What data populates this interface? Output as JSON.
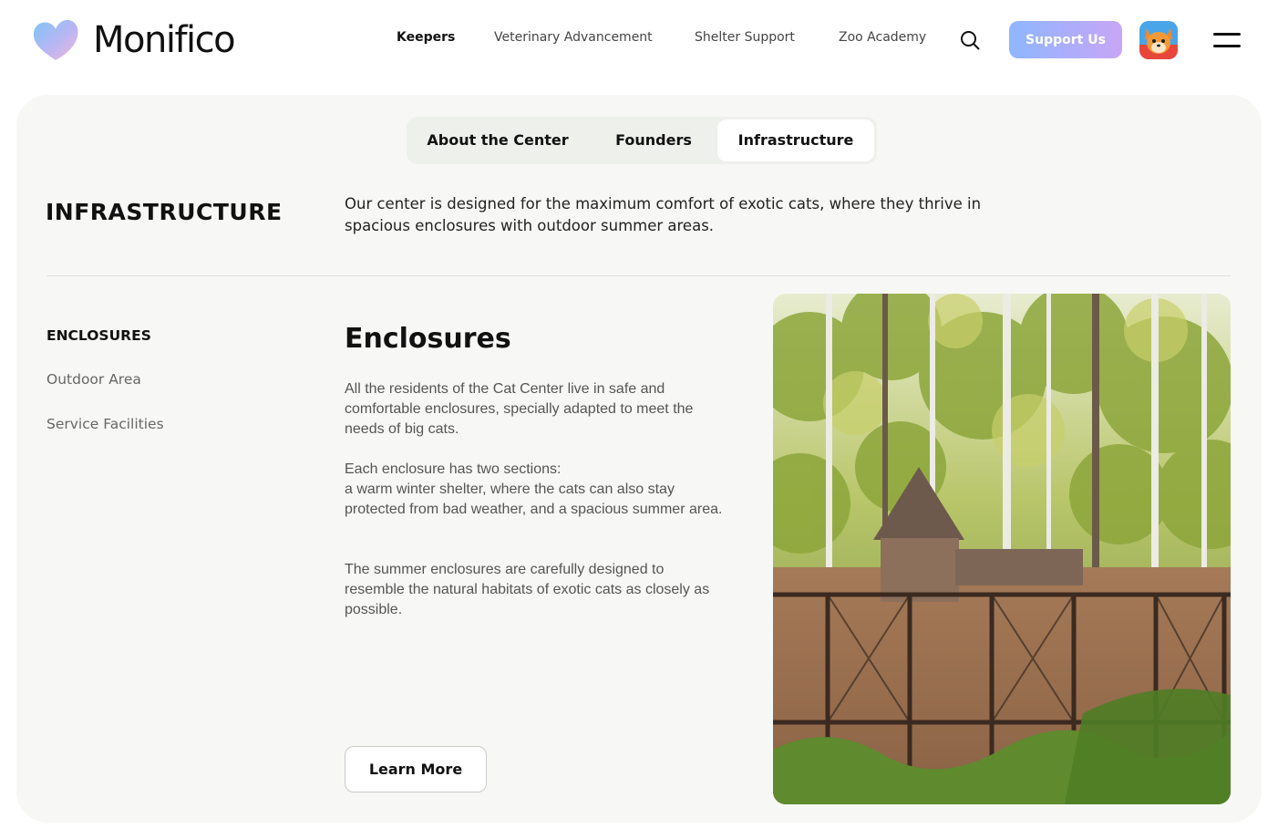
{
  "brand": {
    "name": "Monifico"
  },
  "nav": {
    "items": [
      {
        "label": "Keepers",
        "active": true
      },
      {
        "label": "Veterinary Advancement",
        "active": false
      },
      {
        "label": "Shelter Support",
        "active": false
      },
      {
        "label": "Zoo Academy",
        "active": false
      }
    ],
    "support_label": "Support Us",
    "icons": {
      "search": "search-icon",
      "menu": "hamburger-menu-icon",
      "avatar": "fox-avatar"
    }
  },
  "tabs": [
    {
      "label": "About the Center",
      "active": false
    },
    {
      "label": "Founders",
      "active": false
    },
    {
      "label": "Infrastructure",
      "active": true
    }
  ],
  "section": {
    "title": "INFRASTRUCTURE",
    "intro": "Our center is designed for the maximum comfort of exotic cats, where they thrive in spacious enclosures with outdoor summer areas."
  },
  "sidebar": {
    "items": [
      {
        "label": "ENCLOSURES",
        "active": true
      },
      {
        "label": "Outdoor Area",
        "active": false
      },
      {
        "label": "Service Facilities",
        "active": false
      }
    ]
  },
  "content": {
    "title": "Enclosures",
    "paragraphs": [
      "All the residents of the Cat Center live in safe and comfortable enclosures, specially adapted to meet the needs of big cats.",
      "Each enclosure has two sections:\na warm winter shelter, where the cats can also stay protected from bad weather, and a spacious summer area.",
      "The summer enclosures are carefully designed to resemble the natural habitats of exotic cats as closely as possible."
    ],
    "cta_label": "Learn More",
    "photo": "forest-enclosure-photo"
  },
  "colors": {
    "accent_gradient_start": "#8fb6ff",
    "accent_gradient_end": "#c7a6f6",
    "card_bg": "#f7f8f6",
    "tab_track": "#eef0ec"
  }
}
